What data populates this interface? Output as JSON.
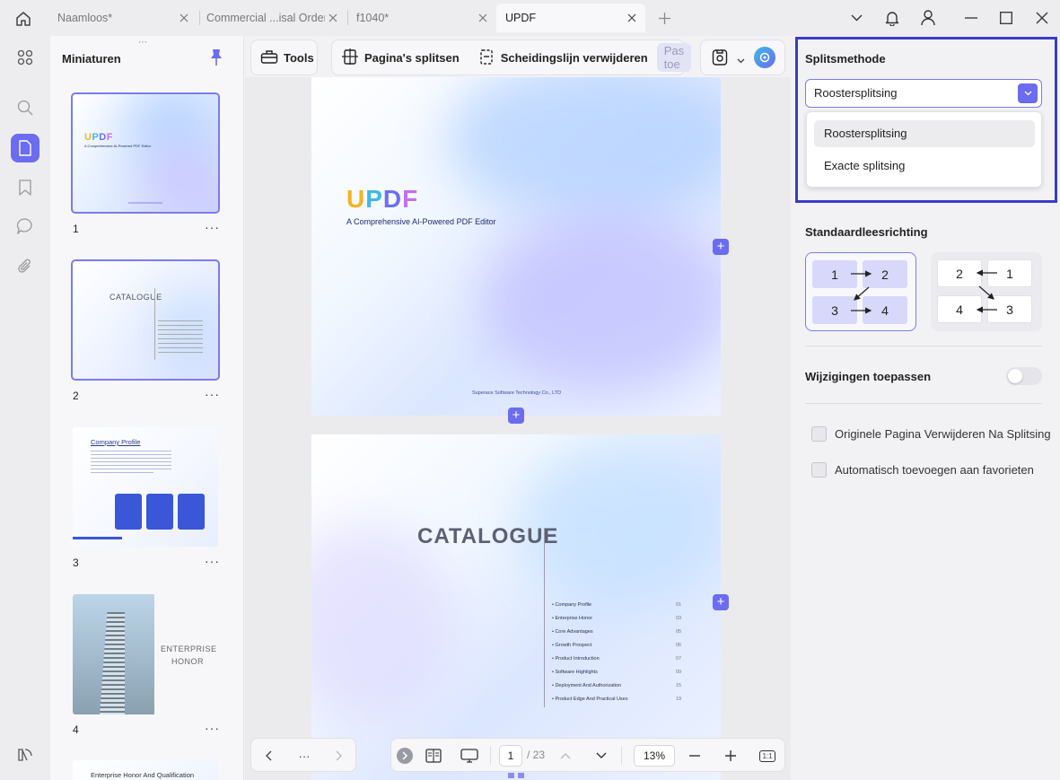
{
  "titlebar": {
    "tabs": [
      {
        "label": "Naamloos*"
      },
      {
        "label": "Commercial ...isal Order*"
      },
      {
        "label": "f1040*"
      },
      {
        "label": "UPDF"
      }
    ]
  },
  "sidebar": {
    "title": "Miniaturen",
    "thumbnails": [
      {
        "number": "1",
        "logo": "UPDF",
        "subtitle": "A Comprehensive AI-Powered PDF Editor"
      },
      {
        "number": "2",
        "heading": "CATALOGUE"
      },
      {
        "number": "3",
        "heading": "Company Profile"
      },
      {
        "number": "4",
        "heading": "ENTERPRISE HONOR"
      },
      {
        "heading": "Enterprise Honor And Qualification"
      }
    ]
  },
  "toolbar": {
    "tools_label": "Tools",
    "split_label": "Pagina's splitsen",
    "remove_line_label": "Scheidingslijn verwijderen",
    "apply_label": "Pas toe"
  },
  "document": {
    "page1": {
      "logo": "UPDF",
      "subtitle": "A Comprehensive AI-Powered PDF Editor",
      "footer": "Superace Software Technology Co., LTD"
    },
    "page2": {
      "title": "CATALOGUE",
      "items": [
        {
          "label": "Company Profile",
          "page": "01"
        },
        {
          "label": "Enterprise Honor",
          "page": "03"
        },
        {
          "label": "Core Advantages",
          "page": "05"
        },
        {
          "label": "Growth Prospect",
          "page": "06"
        },
        {
          "label": "Product Introduction",
          "page": "07"
        },
        {
          "label": "Software Highlights",
          "page": "09"
        },
        {
          "label": "Deployment And Authorization",
          "page": "15"
        },
        {
          "label": "Product Edge And Practical Uses",
          "page": "19"
        }
      ]
    }
  },
  "bottom_nav": {
    "more": "···",
    "current_page": "1",
    "total_pages": "/ 23",
    "zoom": "13%",
    "fit_label": "1:1"
  },
  "right_panel": {
    "split_method_title": "Splitsmethode",
    "selected_method": "Roostersplitsing",
    "options": [
      "Roostersplitsing",
      "Exacte splitsing"
    ],
    "reading_direction_title": "Standaardleesrichting",
    "direction_ltr": [
      "1",
      "2",
      "3",
      "4"
    ],
    "direction_rtl": [
      "2",
      "1",
      "4",
      "3"
    ],
    "apply_changes_label": "Wijzigingen toepassen",
    "apply_changes_on": false,
    "checkbox_delete_original": "Originele Pagina Verwijderen Na Splitsing",
    "checkbox_add_favorites": "Automatisch toevoegen aan favorieten"
  },
  "colors": {
    "accent": "#6b6cf0",
    "highlight_border": "#3a3cc6"
  }
}
